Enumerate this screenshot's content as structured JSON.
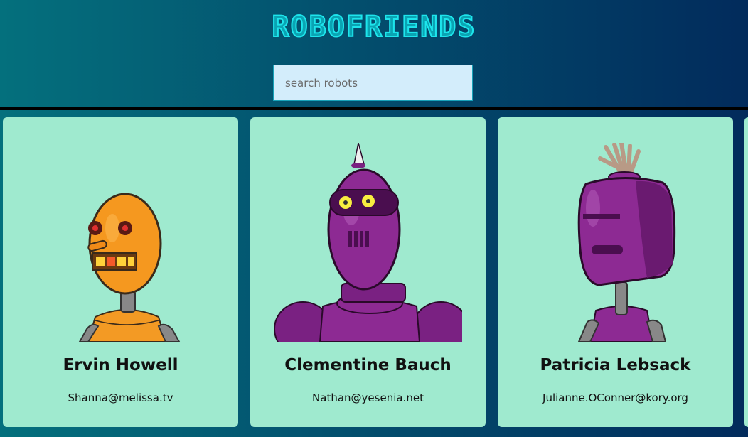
{
  "app": {
    "title": "ROBOFRIENDS"
  },
  "search": {
    "placeholder": "search robots",
    "value": ""
  },
  "colors": {
    "card_bg": "#9feacf",
    "title": "#1de5ec",
    "search_bg": "#d3edfb"
  },
  "robots": [
    {
      "name": "Ervin Howell",
      "email": "Shanna@melissa.tv",
      "avatar": "orange-robot-icon"
    },
    {
      "name": "Clementine Bauch",
      "email": "Nathan@yesenia.net",
      "avatar": "purple-spiked-robot-icon"
    },
    {
      "name": "Patricia Lebsack",
      "email": "Julianne.OConner@kory.org",
      "avatar": "purple-tufted-robot-icon"
    }
  ]
}
